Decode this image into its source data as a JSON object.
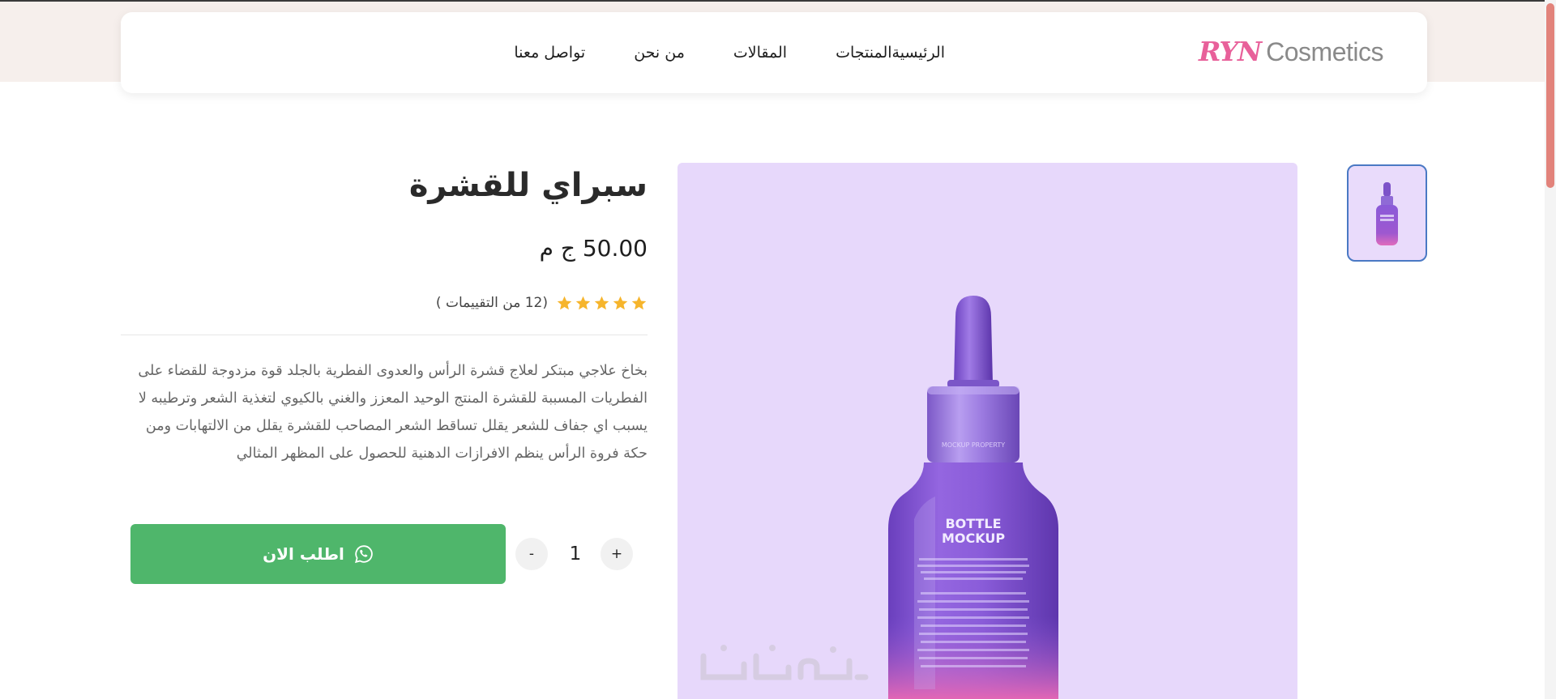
{
  "header": {
    "logo_mark": "RYN",
    "logo_text": "Cosmetics",
    "nav": [
      {
        "label": "الرئيسية"
      },
      {
        "label": "المنتجات"
      },
      {
        "label": "المقالات"
      },
      {
        "label": "من نحن"
      },
      {
        "label": "تواصل معنا"
      }
    ]
  },
  "product": {
    "title": "سبراي للقشرة",
    "price": "50.00 ج م",
    "rating": 5,
    "rating_max": 5,
    "review_count": "(12 من التقييمات )",
    "description": "بخاخ علاجي مبتكر لعلاج قشرة الرأس والعدوى الفطرية بالجلد قوة مزدوجة للقضاء على الفطريات المسببة للقشرة المنتج الوحيد المعزز والغني بالكيوي لتغذية الشعر وترطيبه لا يسبب اي جفاف للشعر يقلل تساقط الشعر المصاحب للقشرة يقلل من الالتهابات ومن حكة فروة الرأس ينظم الافرازات الدهنية للحصول على المظهر المثالي",
    "image_label_line1": "BOTTLE",
    "image_label_line2": "MOCKUP",
    "bottle_neck_text": "MOCKUP PROPERTY"
  },
  "quantity": {
    "plus": "+",
    "value": "1",
    "minus": "-"
  },
  "order": {
    "label": "اطلب الان",
    "icon": "whatsapp-icon",
    "color": "#4fb66b"
  },
  "watermark": "خمسات",
  "colors": {
    "accent_pink": "#e8609a",
    "image_bg": "#e7d8fb",
    "thumb_border": "#4a79c4",
    "star": "#f6b52c",
    "scroll_thumb": "#e2837b"
  }
}
